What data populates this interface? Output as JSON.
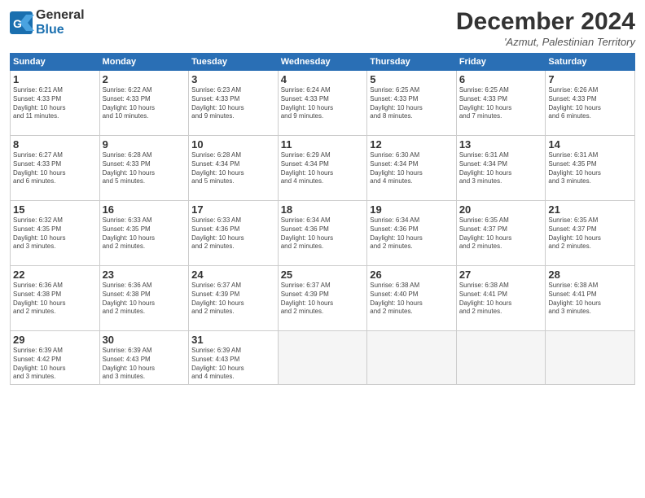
{
  "header": {
    "logo_general": "General",
    "logo_blue": "Blue",
    "month_title": "December 2024",
    "location": "'Azmut, Palestinian Territory"
  },
  "days_of_week": [
    "Sunday",
    "Monday",
    "Tuesday",
    "Wednesday",
    "Thursday",
    "Friday",
    "Saturday"
  ],
  "weeks": [
    [
      {
        "num": "1",
        "info": "Sunrise: 6:21 AM\nSunset: 4:33 PM\nDaylight: 10 hours\nand 11 minutes."
      },
      {
        "num": "2",
        "info": "Sunrise: 6:22 AM\nSunset: 4:33 PM\nDaylight: 10 hours\nand 10 minutes."
      },
      {
        "num": "3",
        "info": "Sunrise: 6:23 AM\nSunset: 4:33 PM\nDaylight: 10 hours\nand 9 minutes."
      },
      {
        "num": "4",
        "info": "Sunrise: 6:24 AM\nSunset: 4:33 PM\nDaylight: 10 hours\nand 9 minutes."
      },
      {
        "num": "5",
        "info": "Sunrise: 6:25 AM\nSunset: 4:33 PM\nDaylight: 10 hours\nand 8 minutes."
      },
      {
        "num": "6",
        "info": "Sunrise: 6:25 AM\nSunset: 4:33 PM\nDaylight: 10 hours\nand 7 minutes."
      },
      {
        "num": "7",
        "info": "Sunrise: 6:26 AM\nSunset: 4:33 PM\nDaylight: 10 hours\nand 6 minutes."
      }
    ],
    [
      {
        "num": "8",
        "info": "Sunrise: 6:27 AM\nSunset: 4:33 PM\nDaylight: 10 hours\nand 6 minutes."
      },
      {
        "num": "9",
        "info": "Sunrise: 6:28 AM\nSunset: 4:33 PM\nDaylight: 10 hours\nand 5 minutes."
      },
      {
        "num": "10",
        "info": "Sunrise: 6:28 AM\nSunset: 4:34 PM\nDaylight: 10 hours\nand 5 minutes."
      },
      {
        "num": "11",
        "info": "Sunrise: 6:29 AM\nSunset: 4:34 PM\nDaylight: 10 hours\nand 4 minutes."
      },
      {
        "num": "12",
        "info": "Sunrise: 6:30 AM\nSunset: 4:34 PM\nDaylight: 10 hours\nand 4 minutes."
      },
      {
        "num": "13",
        "info": "Sunrise: 6:31 AM\nSunset: 4:34 PM\nDaylight: 10 hours\nand 3 minutes."
      },
      {
        "num": "14",
        "info": "Sunrise: 6:31 AM\nSunset: 4:35 PM\nDaylight: 10 hours\nand 3 minutes."
      }
    ],
    [
      {
        "num": "15",
        "info": "Sunrise: 6:32 AM\nSunset: 4:35 PM\nDaylight: 10 hours\nand 3 minutes."
      },
      {
        "num": "16",
        "info": "Sunrise: 6:33 AM\nSunset: 4:35 PM\nDaylight: 10 hours\nand 2 minutes."
      },
      {
        "num": "17",
        "info": "Sunrise: 6:33 AM\nSunset: 4:36 PM\nDaylight: 10 hours\nand 2 minutes."
      },
      {
        "num": "18",
        "info": "Sunrise: 6:34 AM\nSunset: 4:36 PM\nDaylight: 10 hours\nand 2 minutes."
      },
      {
        "num": "19",
        "info": "Sunrise: 6:34 AM\nSunset: 4:36 PM\nDaylight: 10 hours\nand 2 minutes."
      },
      {
        "num": "20",
        "info": "Sunrise: 6:35 AM\nSunset: 4:37 PM\nDaylight: 10 hours\nand 2 minutes."
      },
      {
        "num": "21",
        "info": "Sunrise: 6:35 AM\nSunset: 4:37 PM\nDaylight: 10 hours\nand 2 minutes."
      }
    ],
    [
      {
        "num": "22",
        "info": "Sunrise: 6:36 AM\nSunset: 4:38 PM\nDaylight: 10 hours\nand 2 minutes."
      },
      {
        "num": "23",
        "info": "Sunrise: 6:36 AM\nSunset: 4:38 PM\nDaylight: 10 hours\nand 2 minutes."
      },
      {
        "num": "24",
        "info": "Sunrise: 6:37 AM\nSunset: 4:39 PM\nDaylight: 10 hours\nand 2 minutes."
      },
      {
        "num": "25",
        "info": "Sunrise: 6:37 AM\nSunset: 4:39 PM\nDaylight: 10 hours\nand 2 minutes."
      },
      {
        "num": "26",
        "info": "Sunrise: 6:38 AM\nSunset: 4:40 PM\nDaylight: 10 hours\nand 2 minutes."
      },
      {
        "num": "27",
        "info": "Sunrise: 6:38 AM\nSunset: 4:41 PM\nDaylight: 10 hours\nand 2 minutes."
      },
      {
        "num": "28",
        "info": "Sunrise: 6:38 AM\nSunset: 4:41 PM\nDaylight: 10 hours\nand 3 minutes."
      }
    ],
    [
      {
        "num": "29",
        "info": "Sunrise: 6:39 AM\nSunset: 4:42 PM\nDaylight: 10 hours\nand 3 minutes."
      },
      {
        "num": "30",
        "info": "Sunrise: 6:39 AM\nSunset: 4:43 PM\nDaylight: 10 hours\nand 3 minutes."
      },
      {
        "num": "31",
        "info": "Sunrise: 6:39 AM\nSunset: 4:43 PM\nDaylight: 10 hours\nand 4 minutes."
      },
      null,
      null,
      null,
      null
    ]
  ]
}
